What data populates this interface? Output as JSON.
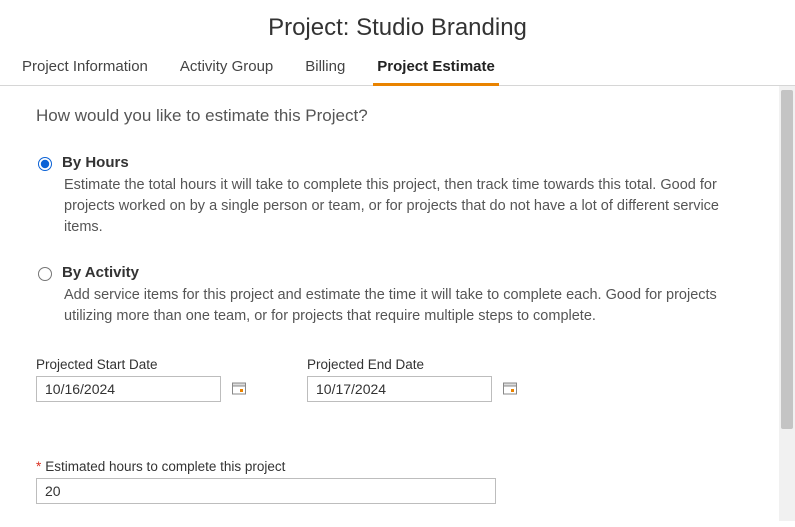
{
  "title": "Project: Studio Branding",
  "tabs": [
    {
      "label": "Project Information",
      "active": false
    },
    {
      "label": "Activity Group",
      "active": false
    },
    {
      "label": "Billing",
      "active": false
    },
    {
      "label": "Project Estimate",
      "active": true
    }
  ],
  "question": "How would you like to estimate this Project?",
  "options": {
    "byHours": {
      "label": "By Hours",
      "desc": "Estimate the total hours it will take to complete this project, then track time towards this total. Good for projects worked on by a single person or team, or for projects that do not have a lot of different service items.",
      "selected": true
    },
    "byActivity": {
      "label": "By Activity",
      "desc": "Add service items for this project and estimate the time it will take to complete each. Good for projects utilizing more than one team, or for projects that require multiple steps to complete.",
      "selected": false
    }
  },
  "dates": {
    "start": {
      "label": "Projected Start Date",
      "value": "10/16/2024"
    },
    "end": {
      "label": "Projected End Date",
      "value": "10/17/2024"
    }
  },
  "estimate": {
    "label": "Estimated hours to complete this project",
    "value": "20"
  }
}
